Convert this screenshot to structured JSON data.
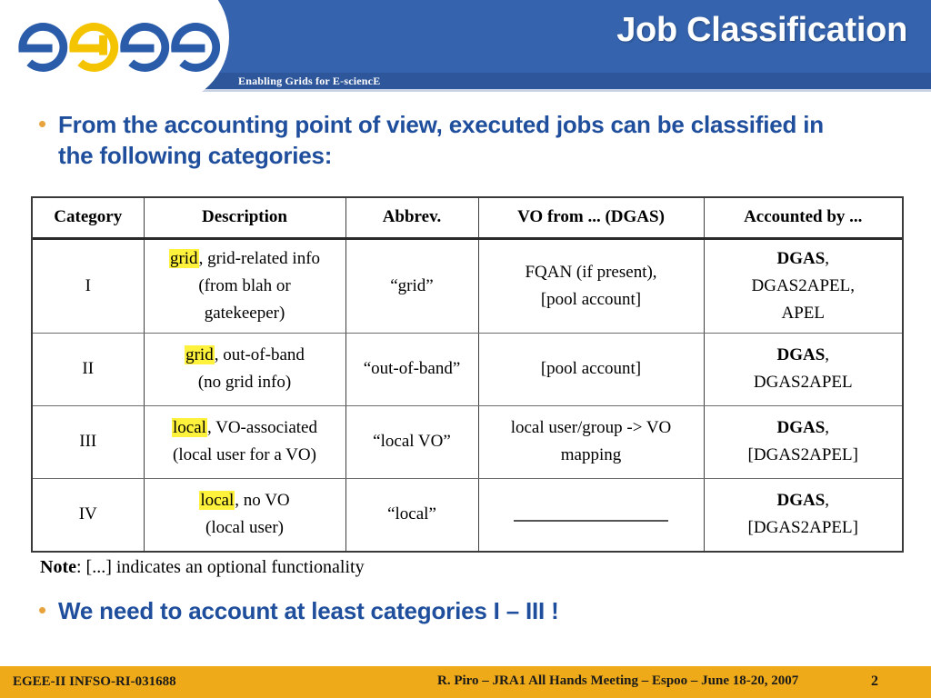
{
  "header": {
    "title": "Job Classification",
    "tagline": "Enabling Grids for E-sciencE",
    "logo_text": "egee",
    "brand_blue": "#3563ad",
    "brand_strip_blue": "#2e569b",
    "logo_blue": "#2a5caa",
    "logo_yellow": "#f5c400"
  },
  "bullets": {
    "top": {
      "marker": "•",
      "text": "From the accounting point of view, executed jobs can be classified in the following categories:"
    },
    "bottom": {
      "marker": "•",
      "text": "We need to account at least categories I – III !"
    },
    "bullet_color": "#1f4e9c",
    "marker_color": "#e8a33d"
  },
  "table": {
    "columns": [
      "Category",
      "Description",
      "Abbrev.",
      "VO from ... (DGAS)",
      "Accounted by ..."
    ],
    "highlight_color": "#fff23c",
    "rows": [
      {
        "category": "I",
        "desc_highlight": "grid",
        "desc_rest": ", grid-related info",
        "desc_line2": "(from blah or",
        "desc_line3": "gatekeeper)",
        "abbrev": "“grid”",
        "vo_line1": "FQAN (if present),",
        "vo_line2": "[pool account]",
        "acc_bold": "DGAS",
        "acc_rest": ",",
        "acc_line2": "DGAS2APEL,",
        "acc_line3": "APEL"
      },
      {
        "category": "II",
        "desc_highlight": "grid",
        "desc_rest": ", out-of-band",
        "desc_line2": "(no grid info)",
        "desc_line3": "",
        "abbrev": "“out-of-band”",
        "vo_line1": "[pool account]",
        "vo_line2": "",
        "acc_bold": "DGAS",
        "acc_rest": ",",
        "acc_line2": "DGAS2APEL",
        "acc_line3": ""
      },
      {
        "category": "III",
        "desc_highlight": "local",
        "desc_rest": ", VO-associated",
        "desc_line2": "(local user for a VO)",
        "desc_line3": "",
        "abbrev": "“local VO”",
        "vo_line1": "local user/group -> VO",
        "vo_line2": "mapping",
        "acc_bold": "DGAS",
        "acc_rest": ",",
        "acc_line2": "[DGAS2APEL]",
        "acc_line3": ""
      },
      {
        "category": "IV",
        "desc_highlight": "local",
        "desc_rest": ", no VO",
        "desc_line2": "(local user)",
        "desc_line3": "",
        "abbrev": "“local”",
        "vo_line1": "",
        "vo_line2": "",
        "acc_bold": "DGAS",
        "acc_rest": ",",
        "acc_line2": "[DGAS2APEL]",
        "acc_line3": ""
      }
    ]
  },
  "note": {
    "label": "Note",
    "text": ": [...] indicates an optional functionality"
  },
  "footer": {
    "left": "EGEE-II INFSO-RI-031688",
    "center": "R. Piro – JRA1 All Hands Meeting – Espoo – June 18-20, 2007",
    "page": "2",
    "bar_color": "#eeaa18"
  }
}
